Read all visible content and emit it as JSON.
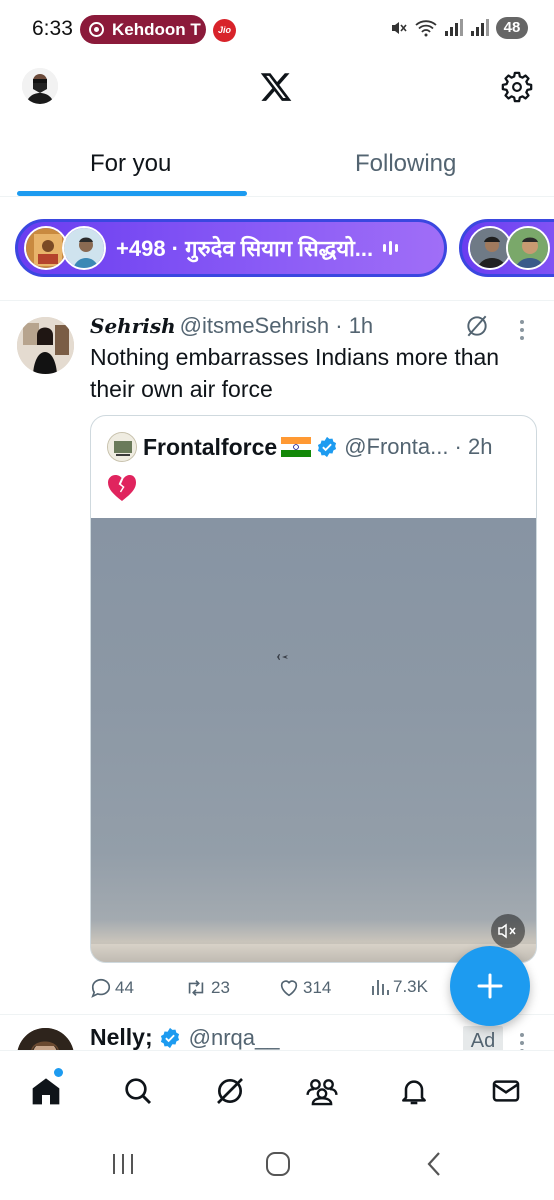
{
  "status_bar": {
    "time": "6:33",
    "live_pill": "Kehdoon T",
    "carrier_badge": "Jio",
    "battery": "48"
  },
  "top_bar": {
    "logo": "x-logo-icon",
    "settings": "gear-icon"
  },
  "tabs": [
    {
      "label": "For you",
      "active": true
    },
    {
      "label": "Following",
      "active": false
    }
  ],
  "spaces": {
    "label": "+498 · गुरुदेव सियाग सिद्धयो..."
  },
  "tweet": {
    "name": "Sehrish",
    "handle": "@itsmeSehrish · 1h",
    "text": "Nothing embarrasses Indians more than their own air force",
    "quote": {
      "name": "Frontalforce",
      "handle": "@Fronta... · 2h",
      "emoji": "💔"
    },
    "actions": {
      "replies": "44",
      "reposts": "23",
      "likes": "314",
      "views": "7.3K"
    }
  },
  "next_tweet": {
    "name": "Nelly;",
    "handle": "@nrqa__",
    "ad_label": "Ad"
  },
  "colors": {
    "accent": "#1d9bf0",
    "spaces_gradient": "#7c4dff",
    "live_pill": "#8b1a3a"
  }
}
